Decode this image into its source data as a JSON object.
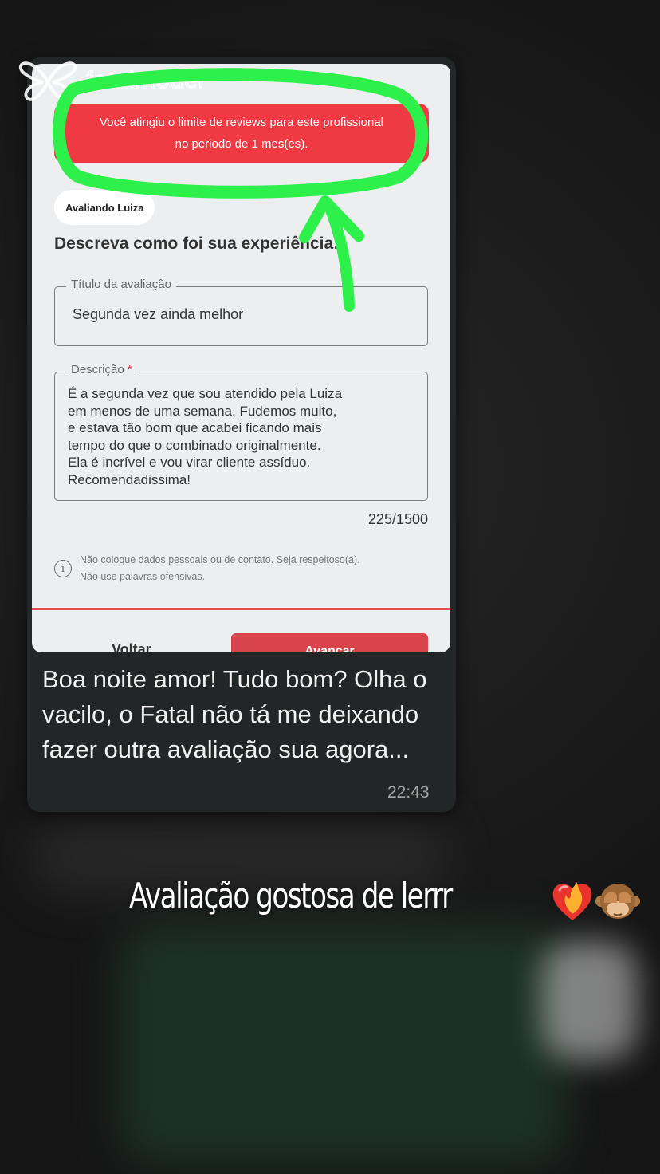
{
  "screenshot": {
    "brand": "fatalmodel",
    "alert_line1": "Você atingiu o limite de reviews para este profissional",
    "alert_line2": "no periodo de 1 mes(es).",
    "chip": "Avaliando Luiza",
    "heading": "Descreva como foi sua experiência:",
    "title_field": {
      "label": "Título da avaliação",
      "value": "Segunda vez ainda melhor"
    },
    "description_field": {
      "label": "Descrição",
      "required_mark": "*",
      "value": "É a segunda vez que sou atendido pela Luiza\nem menos de uma semana. Fudemos muito,\ne estava tão bom que acabei ficando mais\ntempo do que o combinado originalmente.\nEla é incrível e vou virar cliente assíduo.\nRecomendadissima!"
    },
    "counter": "225/1500",
    "info_icon": "i",
    "info_text": "Não coloque dados pessoais ou de contato. Seja respeitoso(a).\nNão use palavras ofensivas.",
    "back_label": "Voltar",
    "next_label": "Avançar"
  },
  "message": {
    "text": "Boa noite amor! Tudo bom? Olha o vacilo, o Fatal não tá me deixando fazer outra avaliação sua agora...",
    "time": "22:43"
  },
  "story_caption": "Avaliação gostosa de lerrr",
  "colors": {
    "alert": "#ef3a44",
    "highlight": "#2df04a",
    "bubble": "#232626",
    "button": "#d9434c"
  },
  "icons": [
    "butterfly-logo-icon",
    "info-icon",
    "heart-on-fire-emoji",
    "see-no-evil-monkey-emoji"
  ]
}
